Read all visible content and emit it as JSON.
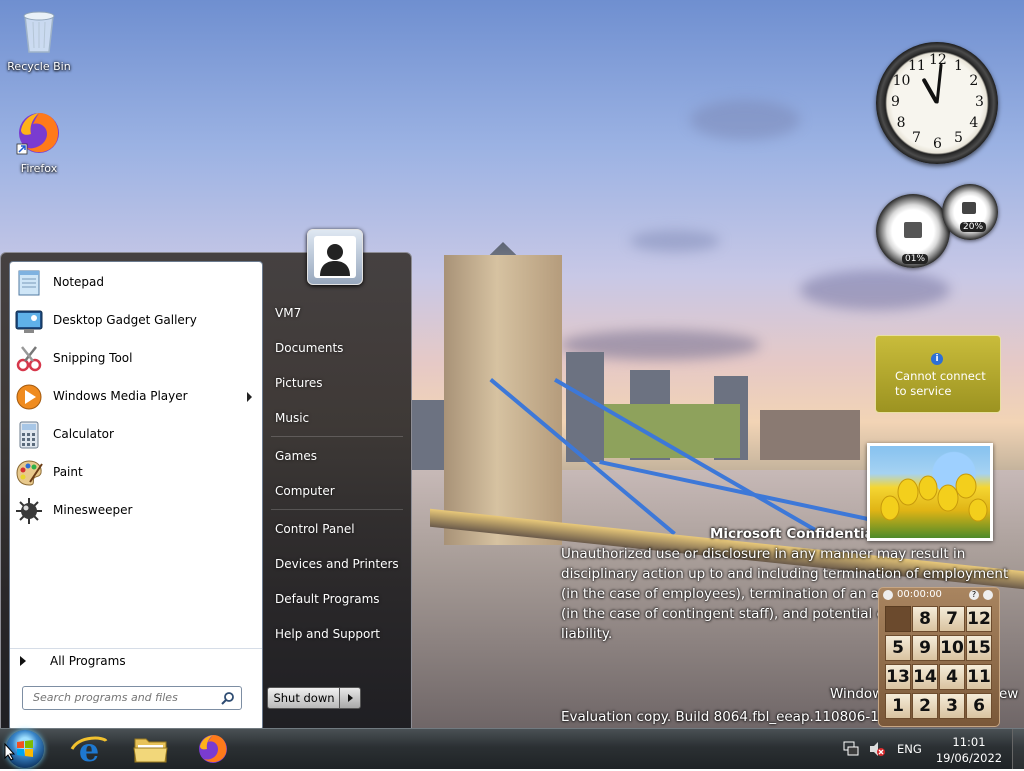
{
  "desktop": {
    "icons": [
      {
        "label": "Recycle Bin",
        "icon": "recycle-bin-icon"
      },
      {
        "label": "Firefox",
        "icon": "firefox-icon"
      }
    ],
    "watermark": {
      "title": "Microsoft Confidential",
      "lines": [
        "Unauthorized use or disclosure in any manner may result in",
        "disciplinary action up to and including termination of employment",
        "(in the case of employees), termination of an as",
        "(in the case of contingent staff), and potential ci",
        "liability."
      ],
      "edition": "Windows",
      "edition_tail": "ew",
      "build": "Evaluation copy. Build 8064.fbl_eeap.110806-1000"
    }
  },
  "gadgets": {
    "clock": {
      "hour": 11,
      "minute": 1
    },
    "cpu_meter": {
      "cpu_percent": "01%",
      "memory_percent": "20%"
    },
    "weather": {
      "message_line1": "Cannot connect",
      "message_line2": "to service"
    },
    "puzzle": {
      "timer": "00:00:00",
      "tiles": [
        "",
        "8",
        "7",
        "12",
        "5",
        "9",
        "10",
        "15",
        "13",
        "14",
        "4",
        "11",
        "1",
        "2",
        "3",
        "6"
      ]
    }
  },
  "start_menu": {
    "programs": [
      {
        "label": "Notepad",
        "icon": "notepad-icon"
      },
      {
        "label": "Desktop Gadget Gallery",
        "icon": "gadget-gallery-icon"
      },
      {
        "label": "Snipping Tool",
        "icon": "scissors-icon"
      },
      {
        "label": "Windows Media Player",
        "icon": "media-player-icon",
        "has_submenu": true
      },
      {
        "label": "Calculator",
        "icon": "calculator-icon"
      },
      {
        "label": "Paint",
        "icon": "paint-palette-icon"
      },
      {
        "label": "Minesweeper",
        "icon": "minesweeper-icon"
      }
    ],
    "all_programs": "All Programs",
    "search_placeholder": "Search programs and files",
    "right_items": [
      "VM7",
      "Documents",
      "Pictures",
      "Music",
      "Games",
      "Computer",
      "Control Panel",
      "Devices and Printers",
      "Default Programs",
      "Help and Support"
    ],
    "shutdown_label": "Shut down"
  },
  "taskbar": {
    "pinned": [
      {
        "name": "internet-explorer",
        "icon": "internet-explorer-icon"
      },
      {
        "name": "windows-explorer",
        "icon": "folder-icon"
      },
      {
        "name": "firefox",
        "icon": "firefox-icon"
      }
    ],
    "tray": {
      "language": "ENG",
      "time": "11:01",
      "date": "19/06/2022"
    }
  },
  "colors": {
    "ie_blue": "#1e78d0",
    "firefox_orange": "#ff7a1a",
    "weather_yellow": "#c9bc3b"
  }
}
